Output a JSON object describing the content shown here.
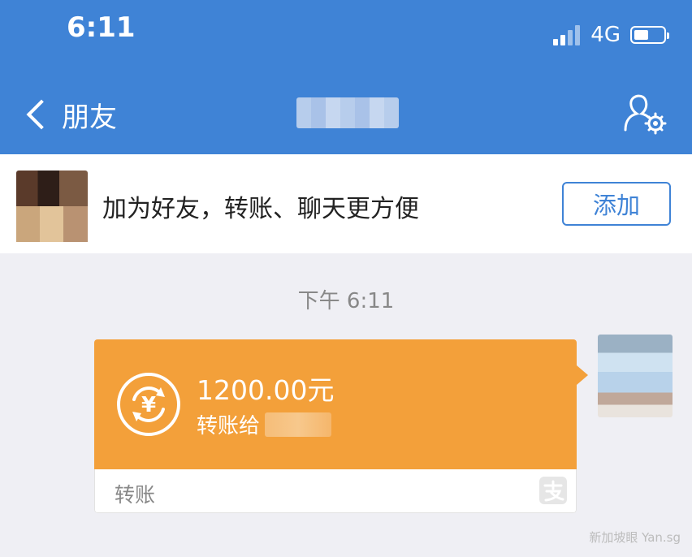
{
  "status_bar": {
    "time": "6:11",
    "network": "4G",
    "battery_level": 0.5
  },
  "nav": {
    "back_label": "朋友",
    "title": "",
    "profile_icon": "profile-settings-icon"
  },
  "add_friend": {
    "text": "加为好友，转账、聊天更方便",
    "button_label": "添加"
  },
  "chat": {
    "timestamp": "下午 6:11",
    "transfer_card": {
      "amount": "1200.00元",
      "subtitle": "转账给",
      "recipient": "",
      "label": "转账",
      "icon": "yuan-transfer-icon",
      "brand_icon": "alipay-icon"
    }
  },
  "watermark": "新加坡眼 Yan.sg",
  "colors": {
    "header": "#3f83d6",
    "transfer_card": "#f3a03a",
    "background": "#efeff4"
  }
}
